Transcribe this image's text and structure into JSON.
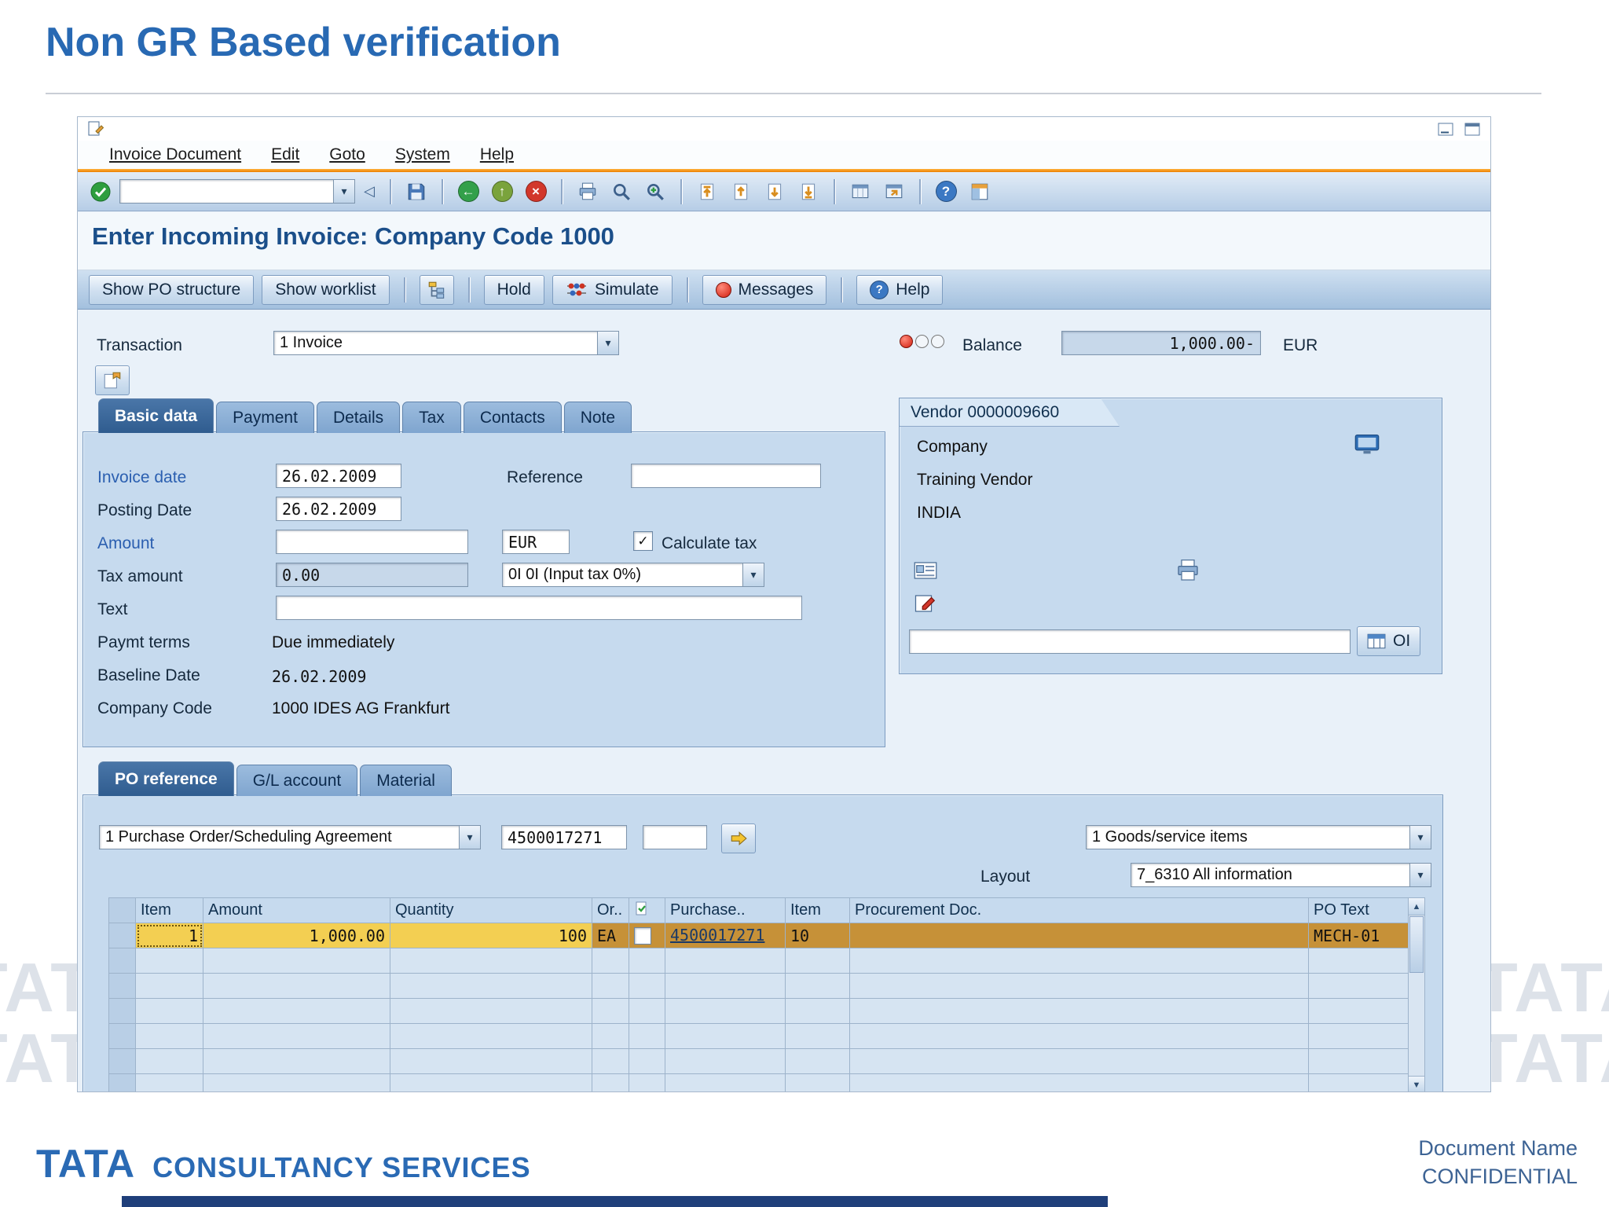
{
  "slide": {
    "title": "Non GR Based verification",
    "watermark": "TATA",
    "footer": {
      "brand": "TATA",
      "brand_suffix": "CONSULTANCY SERVICES",
      "document_name": "Document Name",
      "confidential": "CONFIDENTIAL"
    }
  },
  "colors": {
    "accent_orange": "#ec7f00",
    "title_blue": "#2869b3",
    "band_blue": "#a3c0de",
    "panel_blue": "#c6daee",
    "selected_row": "#c69138",
    "selected_cell": "#f3cf52"
  },
  "icons": {
    "dropdown": "▾",
    "check": "✓",
    "back": "←",
    "exit": "↑",
    "cancel": "×",
    "help": "?",
    "history": "◁",
    "up": "▲",
    "down": "▼"
  },
  "sap": {
    "menu": [
      "Invoice Document",
      "Edit",
      "Goto",
      "System",
      "Help"
    ],
    "screen_title": "Enter Incoming Invoice: Company Code 1000",
    "appbar": {
      "show_po_structure": "Show PO structure",
      "show_worklist": "Show worklist",
      "hold": "Hold",
      "simulate": "Simulate",
      "messages": "Messages",
      "help": "Help"
    },
    "transaction": {
      "label": "Transaction",
      "value": "1 Invoice"
    },
    "balance": {
      "label": "Balance",
      "value": "1,000.00-",
      "currency": "EUR"
    },
    "tabs": [
      {
        "label": "Basic data"
      },
      {
        "label": "Payment"
      },
      {
        "label": "Details"
      },
      {
        "label": "Tax"
      },
      {
        "label": "Contacts"
      },
      {
        "label": "Note"
      }
    ],
    "form": {
      "invoice_date": {
        "label": "Invoice date",
        "value": "26.02.2009"
      },
      "reference": {
        "label": "Reference",
        "value": ""
      },
      "posting_date": {
        "label": "Posting Date",
        "value": "26.02.2009"
      },
      "amount": {
        "label": "Amount",
        "value": "",
        "currency": "EUR"
      },
      "calculate_tax": {
        "label": "Calculate tax",
        "checked": true
      },
      "tax_amount": {
        "label": "Tax amount",
        "value": "0.00",
        "tax_code": "0I 0I (Input tax 0%)"
      },
      "text": {
        "label": "Text",
        "value": ""
      },
      "paymt_terms": {
        "label": "Paymt terms",
        "value": "Due immediately"
      },
      "baseline_date": {
        "label": "Baseline Date",
        "value": "26.02.2009"
      },
      "company_code": {
        "label": "Company Code",
        "value": "1000 IDES AG Frankfurt"
      }
    },
    "vendor": {
      "header": "Vendor 0000009660",
      "line1": "Company",
      "line2": "Training Vendor",
      "line3": "INDIA",
      "oi_label": "OI"
    },
    "item_tabs": [
      {
        "label": "PO reference"
      },
      {
        "label": "G/L account"
      },
      {
        "label": "Material"
      }
    ],
    "po_section": {
      "po_type": "1 Purchase Order/Scheduling Agreement",
      "po_number": "4500017271",
      "po_item": "",
      "items_filter": "1 Goods/service items",
      "layout_label": "Layout",
      "layout_value": "7_6310 All information"
    },
    "table": {
      "headers": [
        "Item",
        "Amount",
        "Quantity",
        "Or..",
        "",
        "Purchase..",
        "Item",
        "Procurement Doc.",
        "PO Text"
      ],
      "row": {
        "item": "1",
        "amount": "1,000.00",
        "quantity": "100",
        "unit": "EA",
        "purchase": "4500017271",
        "po_item": "10",
        "procurement_doc": "",
        "po_text": "MECH-01"
      }
    }
  }
}
